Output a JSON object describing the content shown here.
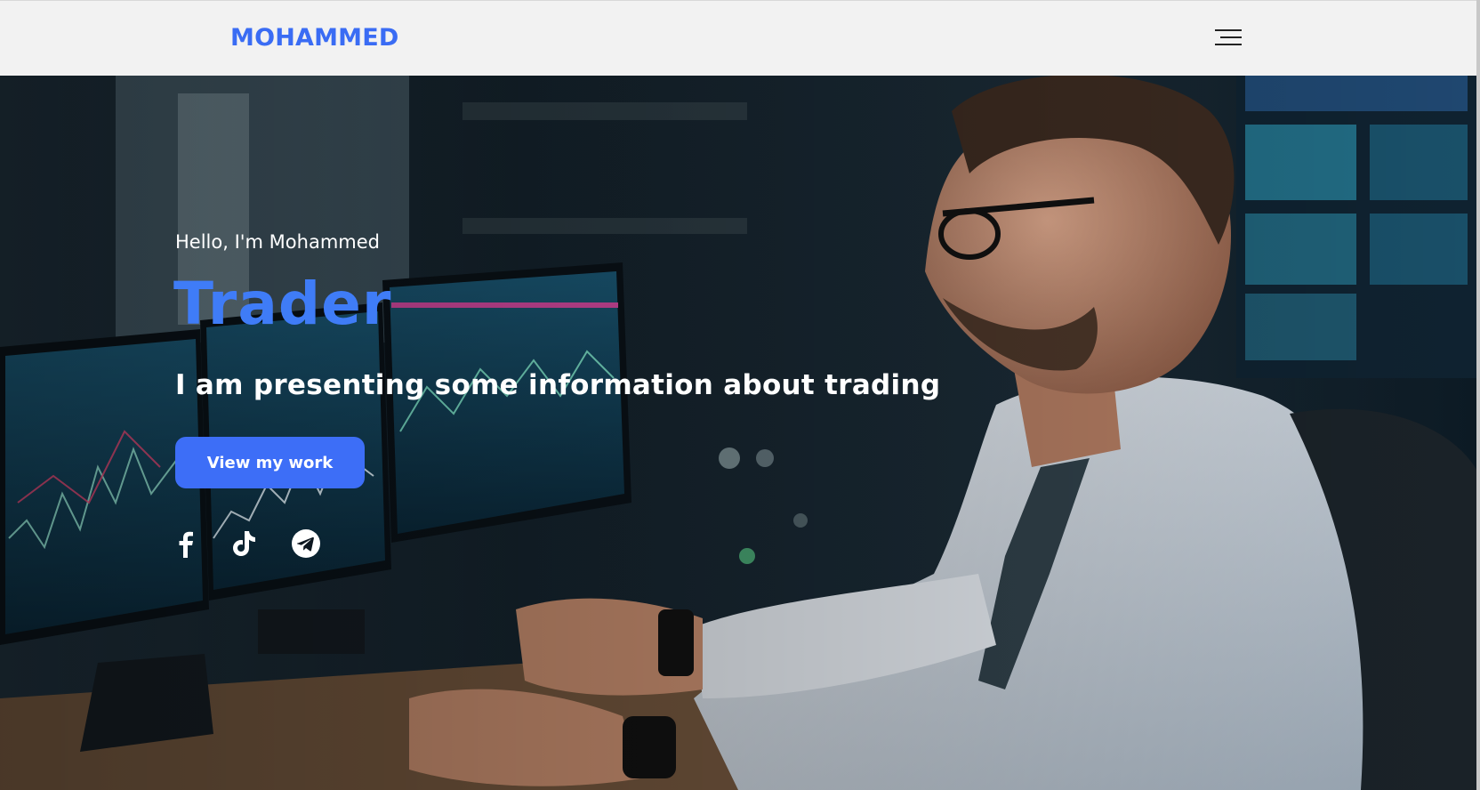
{
  "header": {
    "brand": "MOHAMMED",
    "menu_icon": "hamburger-menu-icon"
  },
  "hero": {
    "greeting": "Hello, I'm Mohammed",
    "role": "Trader",
    "tagline": "I am presenting some information about trading",
    "cta_label": "View my work",
    "background": "trader-at-monitors-photo",
    "socials": [
      {
        "name": "facebook",
        "icon": "facebook-icon"
      },
      {
        "name": "tiktok",
        "icon": "tiktok-icon"
      },
      {
        "name": "telegram",
        "icon": "telegram-icon"
      }
    ]
  },
  "colors": {
    "accent": "#3a6cf4",
    "role_text": "#3f7cf7",
    "navbar_bg": "#f2f2f2",
    "hero_text": "#ffffff"
  }
}
